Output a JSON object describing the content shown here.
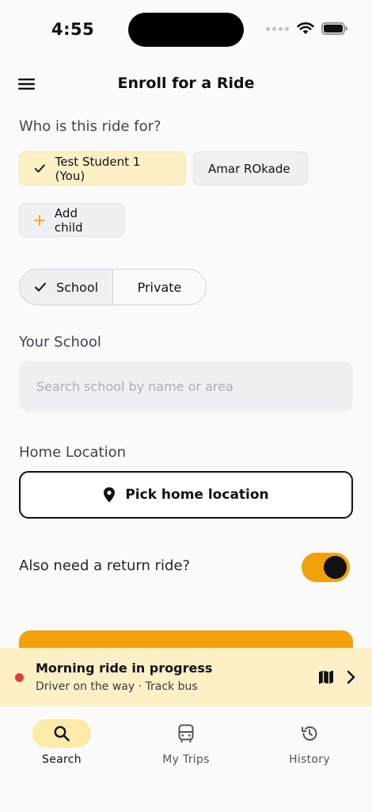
{
  "status_bar": {
    "time": "4:55"
  },
  "header": {
    "title": "Enroll for a Ride"
  },
  "rider": {
    "label": "Who is this ride for?",
    "options": [
      {
        "label": "Test Student 1 (You)",
        "selected": true
      },
      {
        "label": "Amar ROkade",
        "selected": false
      }
    ],
    "add_child_label": "Add child"
  },
  "ride_type": {
    "options": [
      {
        "label": "School",
        "selected": true
      },
      {
        "label": "Private",
        "selected": false
      }
    ]
  },
  "school": {
    "label": "Your School",
    "placeholder": "Search school by name or area",
    "value": ""
  },
  "home": {
    "label": "Home Location",
    "button_label": "Pick home location"
  },
  "return_ride": {
    "label": "Also need a return ride?",
    "enabled": true
  },
  "banner": {
    "title": "Morning ride in progress",
    "subtitle": "Driver on the way · Track bus"
  },
  "nav": {
    "items": [
      {
        "label": "Search",
        "icon": "search-icon",
        "active": true
      },
      {
        "label": "My Trips",
        "icon": "bus-icon",
        "active": false
      },
      {
        "label": "History",
        "icon": "history-icon",
        "active": false
      }
    ]
  },
  "colors": {
    "accent": "#f2a10d",
    "chip_selected": "#fdf0c6",
    "banner_bg": "#fdf0c6",
    "live_dot": "#e53935",
    "nav_active": "#fde9a8"
  }
}
